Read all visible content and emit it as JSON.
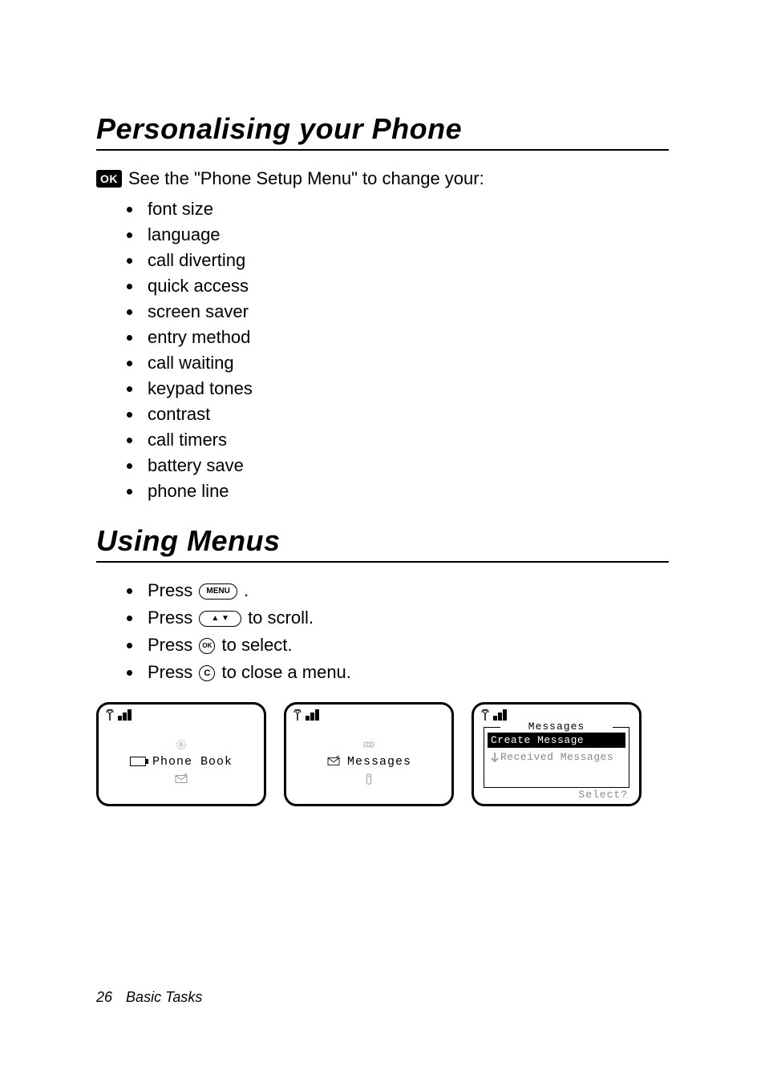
{
  "heading1": "Personalising your Phone",
  "ok_label": "OK",
  "intro_text": " See the \"Phone Setup Menu\" to change your:",
  "bullets": [
    "font size",
    "language",
    "call diverting",
    "quick access",
    "screen saver",
    "entry method",
    "call waiting",
    "keypad tones",
    "contrast",
    "call timers",
    "battery save",
    "phone line"
  ],
  "heading2": "Using Menus",
  "steps": {
    "press": "Press ",
    "menu_key": "MENU",
    "step1_after": ".",
    "scroll_key": "▲  ▼",
    "step2_after": " to scroll.",
    "ok_key": "OK",
    "step3_after": " to select.",
    "c_key": "C",
    "step4_after": " to close a menu."
  },
  "screens": {
    "s1": {
      "label": "Phone Book"
    },
    "s2": {
      "label": "Messages"
    },
    "s3": {
      "title": "Messages",
      "row1": "Create Message",
      "row2": "Received Messages",
      "select": "Select?"
    }
  },
  "footer": {
    "page": "26",
    "chapter": "Basic Tasks"
  }
}
